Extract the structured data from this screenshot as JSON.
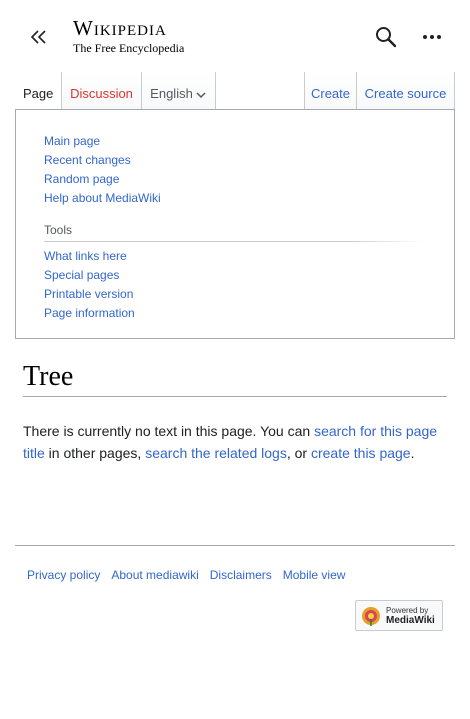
{
  "header": {
    "wordmark": "Wikipedia",
    "tagline": "The Free Encyclopedia"
  },
  "tabs": {
    "page": "Page",
    "discussion": "Discussion",
    "language": "English",
    "create": "Create",
    "create_source": "Create source"
  },
  "menu": {
    "navigation": [
      "Main page",
      "Recent changes",
      "Random page",
      "Help about MediaWiki"
    ],
    "tools_heading": "Tools",
    "tools": [
      "What links here",
      "Special pages",
      "Printable version",
      "Page information"
    ]
  },
  "content": {
    "title": "Tree",
    "text_1": "There is currently no text in this page. You can ",
    "link_search": "search for this page title",
    "text_2": " in other pages, ",
    "link_logs": "search the related logs",
    "text_3": ", or ",
    "link_create": "create this page",
    "text_4": "."
  },
  "footer": {
    "links": [
      "Privacy policy",
      "About mediawiki",
      "Disclaimers",
      "Mobile view"
    ],
    "powered_small": "Powered by",
    "powered_big": "MediaWiki"
  },
  "colors": {
    "link": "#3366cc",
    "new_link": "#dd3333",
    "border": "#a2a9b1"
  }
}
